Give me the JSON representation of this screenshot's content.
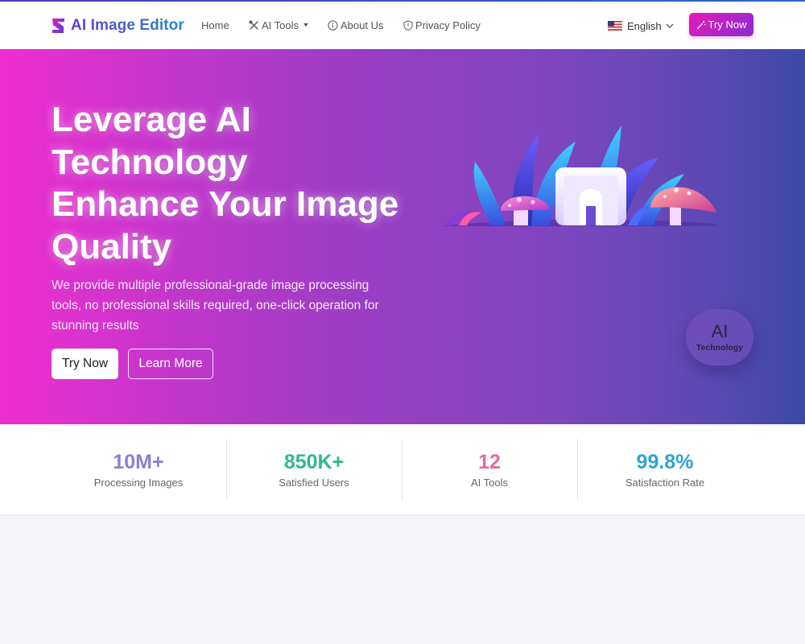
{
  "brand": {
    "name": "AI Image Editor"
  },
  "nav": {
    "home": "Home",
    "ai_tools": "AI Tools",
    "about": "About Us",
    "privacy": "Privacy Policy",
    "language": "English",
    "try_now": "Try Now"
  },
  "hero": {
    "title_lines": [
      "Leverage AI",
      "Technology",
      "Enhance Your Image",
      "Quality"
    ],
    "description": "We provide multiple professional-grade image processing tools, no professional skills required, one-click operation for stunning results",
    "primary_button": "Try Now",
    "secondary_button": "Learn More",
    "badge_big": "AI",
    "badge_small": "Technology"
  },
  "stats": [
    {
      "value": "10M+",
      "label": "Processing Images",
      "color": "#8a7fd6"
    },
    {
      "value": "850K+",
      "label": "Satisfied Users",
      "color": "#2fb88e"
    },
    {
      "value": "12",
      "label": "AI Tools",
      "color": "#e66aa6"
    },
    {
      "value": "99.8%",
      "label": "Satisfaction Rate",
      "color": "#2ea3d8"
    }
  ],
  "colors": {
    "accent": "#e21bb9",
    "hero_start": "#f02ed0",
    "hero_end": "#3c4aa7"
  },
  "icons": [
    "brand-logo-icon",
    "tools-icon",
    "info-icon",
    "shield-icon",
    "us-flag-icon",
    "chevron-down-icon",
    "magic-wand-icon"
  ]
}
